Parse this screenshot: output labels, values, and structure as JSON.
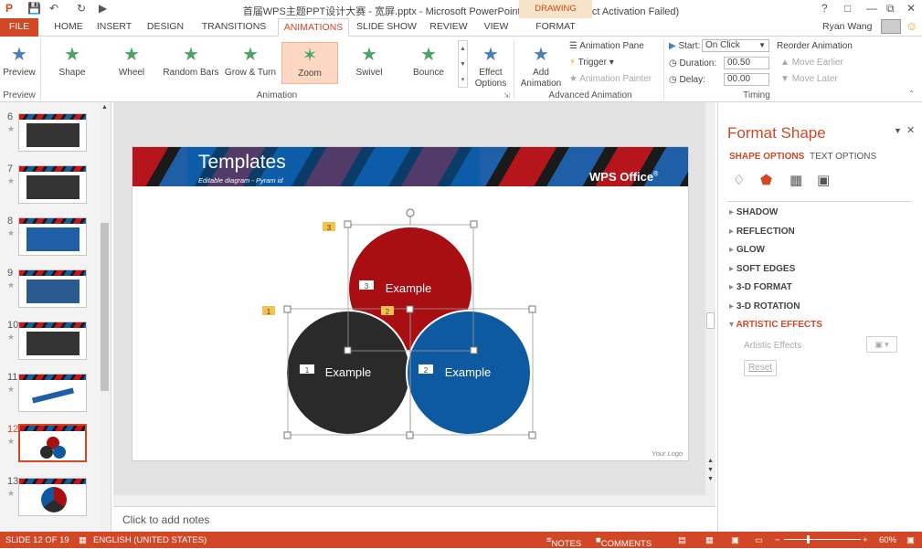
{
  "window": {
    "title": "首届WPS主题PPT设计大赛 - 宽屏.pptx - Microsoft PowerPoint Preview (Product Activation Failed)",
    "context_tab_group": "DRAWING TOOLS",
    "help": "?",
    "user": "Ryan Wang"
  },
  "tabs": [
    "FILE",
    "HOME",
    "INSERT",
    "DESIGN",
    "TRANSITIONS",
    "ANIMATIONS",
    "SLIDE SHOW",
    "REVIEW",
    "VIEW",
    "FORMAT"
  ],
  "ribbon": {
    "preview": {
      "label": "Preview",
      "group": "Preview"
    },
    "animations": [
      {
        "label": "Shape"
      },
      {
        "label": "Wheel"
      },
      {
        "label": "Random Bars"
      },
      {
        "label": "Grow & Turn"
      },
      {
        "label": "Zoom"
      },
      {
        "label": "Swivel"
      },
      {
        "label": "Bounce"
      }
    ],
    "effect_options": "Effect Options",
    "animation_group": "Animation",
    "add_animation": "Add Animation",
    "animation_pane": "Animation Pane",
    "trigger": "Trigger",
    "animation_painter": "Animation Painter",
    "advanced_group": "Advanced Animation",
    "start_label": "Start:",
    "start_value": "On Click",
    "duration_label": "Duration:",
    "duration_value": "00.50",
    "delay_label": "Delay:",
    "delay_value": "00.00",
    "reorder": "Reorder Animation",
    "move_earlier": "Move Earlier",
    "move_later": "Move Later",
    "timing_group": "Timing"
  },
  "thumbnails": [
    {
      "num": "6"
    },
    {
      "num": "7"
    },
    {
      "num": "8"
    },
    {
      "num": "9"
    },
    {
      "num": "10"
    },
    {
      "num": "11"
    },
    {
      "num": "12"
    },
    {
      "num": "13"
    }
  ],
  "slide": {
    "title": "Templates",
    "subtitle": "Editable diagram - Pyram id",
    "brand": "WPS Office",
    "brand_mark": "®",
    "footer": "Your Logo",
    "circles": [
      {
        "label": "Example",
        "badge": "3",
        "color": "#a80e12"
      },
      {
        "label": "Example",
        "badge": "1",
        "color": "#2a2a2a"
      },
      {
        "label": "Example",
        "badge": "2",
        "color": "#0e5aa0"
      }
    ],
    "anim_tags": [
      "3",
      "1",
      "2"
    ]
  },
  "notes_placeholder": "Click to add notes",
  "format_pane": {
    "title": "Format Shape",
    "tab_shape": "SHAPE OPTIONS",
    "tab_text": "TEXT OPTIONS",
    "sections": [
      "SHADOW",
      "REFLECTION",
      "GLOW",
      "SOFT EDGES",
      "3-D FORMAT",
      "3-D ROTATION"
    ],
    "expanded": "ARTISTIC EFFECTS",
    "artistic_label": "Artistic Effects",
    "reset": "Reset"
  },
  "status": {
    "slide": "SLIDE 12 OF 19",
    "language": "ENGLISH (UNITED STATES)",
    "notes": "NOTES",
    "comments": "COMMENTS",
    "zoom": "60%"
  },
  "colors": {
    "accent": "#d24726",
    "zoom_sel": "#fcd7c2",
    "red": "#a80e12",
    "dark": "#2a2a2a",
    "blue": "#0e5aa0"
  }
}
